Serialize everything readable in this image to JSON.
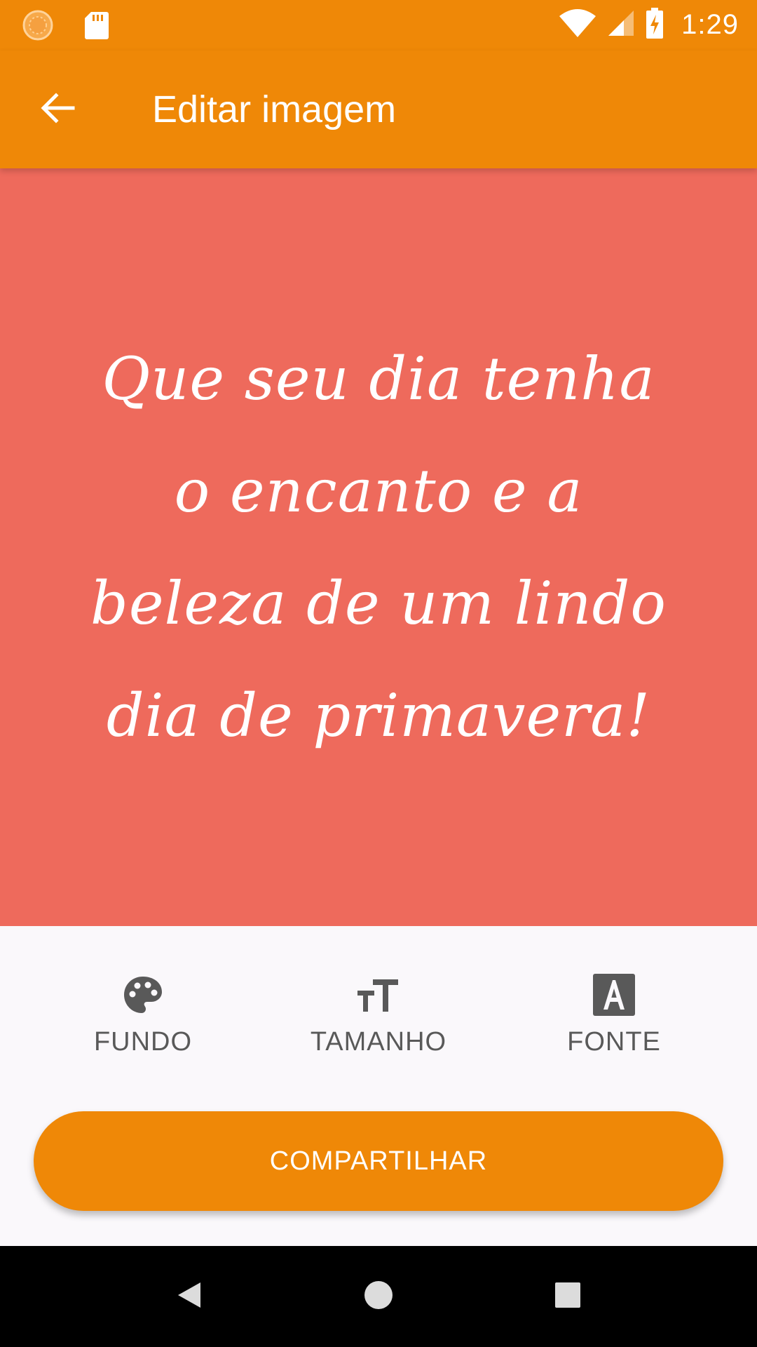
{
  "status_bar": {
    "time": "1:29",
    "icons": [
      "notification-orange-icon",
      "sd-card-icon",
      "wifi-icon",
      "cell-signal-icon",
      "battery-charging-icon"
    ]
  },
  "app_bar": {
    "title": "Editar imagem",
    "back_icon": "arrow-back-icon"
  },
  "canvas": {
    "background_color": "#ee6a5c",
    "quote": "Que seu dia tenha o encanto e a beleza de um lindo dia de primavera!"
  },
  "tools": [
    {
      "label": "FUNDO",
      "icon": "palette-icon"
    },
    {
      "label": "TAMANHO",
      "icon": "text-size-icon"
    },
    {
      "label": "FONTE",
      "icon": "font-icon"
    }
  ],
  "share_button": {
    "label": "COMPARTILHAR"
  },
  "nav_bar": {
    "icons": [
      "nav-back-icon",
      "nav-home-icon",
      "nav-recents-icon"
    ]
  },
  "colors": {
    "accent": "#ef8807",
    "canvas": "#ee6a5c",
    "tool_label": "#595959"
  }
}
